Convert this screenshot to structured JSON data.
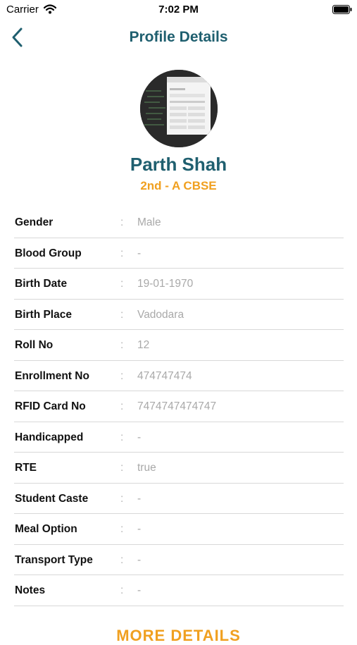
{
  "status_bar": {
    "carrier": "Carrier",
    "time": "7:02 PM"
  },
  "nav": {
    "title": "Profile Details"
  },
  "profile": {
    "name": "Parth Shah",
    "class_label": "2nd - A CBSE"
  },
  "details": {
    "separator": ":",
    "rows": [
      {
        "label": "Gender",
        "value": "Male"
      },
      {
        "label": "Blood Group",
        "value": "-"
      },
      {
        "label": "Birth Date",
        "value": "19-01-1970"
      },
      {
        "label": "Birth Place",
        "value": "Vadodara"
      },
      {
        "label": "Roll No",
        "value": "12"
      },
      {
        "label": "Enrollment No",
        "value": "474747474"
      },
      {
        "label": "RFID Card No",
        "value": "7474747474747"
      },
      {
        "label": "Handicapped",
        "value": "-"
      },
      {
        "label": "RTE",
        "value": "true"
      },
      {
        "label": "Student Caste",
        "value": "-"
      },
      {
        "label": "Meal Option",
        "value": "-"
      },
      {
        "label": "Transport Type",
        "value": "-"
      },
      {
        "label": "Notes",
        "value": "-"
      }
    ]
  },
  "more_details_label": "MORE DETAILS",
  "colors": {
    "title": "#1f5f6f",
    "accent": "#f0a020",
    "value_text": "#a9a9a9",
    "divider": "#d8d8d8"
  },
  "icons": {
    "back": "chevron-left-icon",
    "wifi": "wifi-icon",
    "battery": "battery-icon"
  }
}
